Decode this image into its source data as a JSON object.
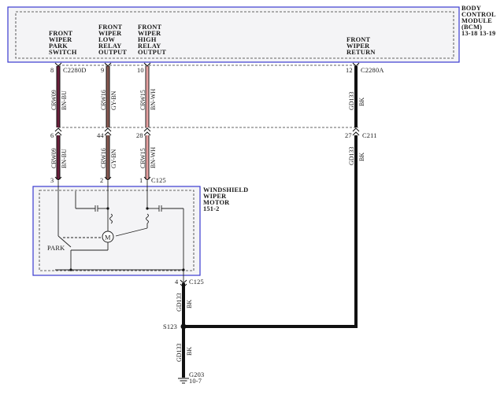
{
  "bcm": {
    "title_lines": [
      "BODY",
      "CONTROL",
      "MODULE",
      "(BCM)",
      "13-18  13-19"
    ],
    "pins": [
      {
        "lines": [
          "FRONT",
          "WIPER",
          "PARK",
          "SWITCH"
        ],
        "pin": "8"
      },
      {
        "lines": [
          "FRONT",
          "WIPER",
          "LOW",
          "RELAY",
          "OUTPUT"
        ],
        "pin": "9"
      },
      {
        "lines": [
          "FRONT",
          "WIPER",
          "HIGH",
          "RELAY",
          "OUTPUT"
        ],
        "pin": "10"
      },
      {
        "lines": [
          "FRONT",
          "WIPER",
          "RETURN"
        ],
        "pin": "12"
      }
    ],
    "connector_left": "C2280D",
    "connector_right": "C2280A"
  },
  "wires": [
    {
      "circuit": "CRW09",
      "color_code": "BN-BU",
      "color": "#6b1f3c"
    },
    {
      "circuit": "CRW16",
      "color_code": "GY-BN",
      "color": "#8a5a52"
    },
    {
      "circuit": "CRW15",
      "color_code": "BN-WH",
      "color": "#d88a8a"
    },
    {
      "circuit": "GD133",
      "color_code": "BK",
      "color": "#111111"
    }
  ],
  "inline_connector": {
    "name": "C211",
    "pins": [
      "6",
      "44",
      "28",
      "27"
    ]
  },
  "motor": {
    "title_lines": [
      "WINDSHIELD",
      "WIPER",
      "MOTOR",
      "151-2"
    ],
    "connector": "C125",
    "pins": [
      "3",
      "2",
      "1"
    ],
    "park_label": "PARK",
    "motor_symbol": "M"
  },
  "ground_path": {
    "connector": "C125",
    "pin": "4",
    "splice": "S123",
    "ground": "G203",
    "ground_ref": "10-7"
  }
}
